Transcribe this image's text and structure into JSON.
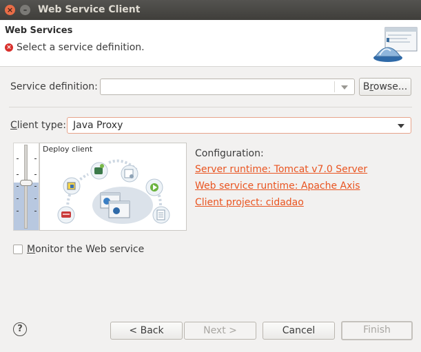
{
  "window": {
    "title": "Web Service Client"
  },
  "banner": {
    "title": "Web Services",
    "message": "Select a service definition."
  },
  "service_definition": {
    "label_prefix": "Service definition:",
    "value": "",
    "browse_button": {
      "mnemonic": "r",
      "before": "B",
      "after": "owse..."
    }
  },
  "client_type": {
    "label_mnemonic": "C",
    "label_rest": "lient type:",
    "value": "Java Proxy"
  },
  "slider": {
    "level_percent": 55
  },
  "diagram": {
    "label": "Deploy client"
  },
  "configuration": {
    "title": "Configuration:",
    "links": [
      "Server runtime: Tomcat v7.0 Server",
      "Web service runtime: Apache Axis",
      "Client project: cidadao"
    ]
  },
  "monitor": {
    "checked": false,
    "label_mnemonic": "M",
    "label_rest": "onitor the Web service"
  },
  "buttons": {
    "back": "< Back",
    "next": "Next >",
    "cancel": "Cancel",
    "finish": "Finish"
  },
  "colors": {
    "link": "#e95420",
    "error": "#d9302c",
    "combo_border_active": "#e7a38a"
  },
  "icons": {
    "help": "help-icon",
    "error": "error-icon"
  }
}
